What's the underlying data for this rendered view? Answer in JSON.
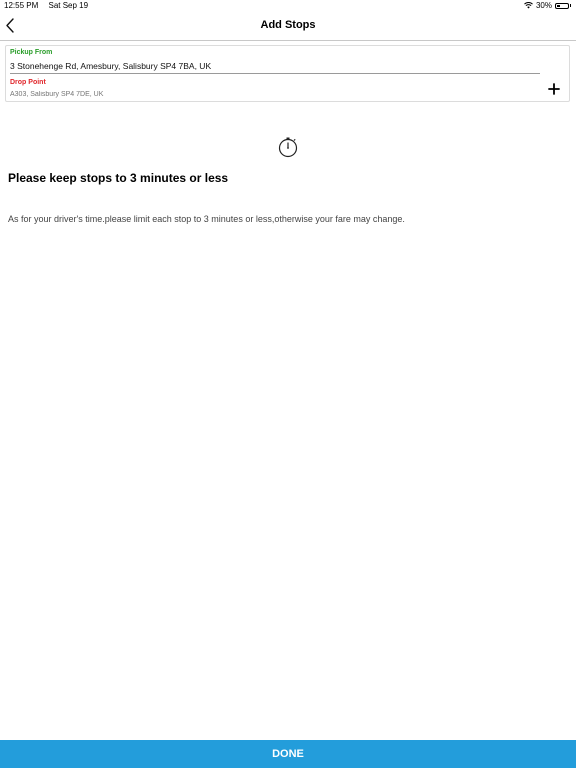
{
  "status_bar": {
    "time": "12:55 PM",
    "date": "Sat Sep 19",
    "battery": "30%",
    "battery_level": 0.3,
    "icons": [
      "wifi-icon",
      "battery-icon"
    ]
  },
  "nav": {
    "title": "Add Stops",
    "back_icon": "chevron-left-icon"
  },
  "stops": {
    "pickup_label": "Pickup From",
    "pickup_value": "3 Stonehenge Rd, Amesbury, Salisbury SP4 7BA, UK",
    "drop_label": "Drop Point",
    "drop_placeholder": "A303, Salisbury SP4 7DE, UK",
    "add_icon": "plus-icon"
  },
  "notice": {
    "icon": "stopwatch-icon",
    "title": "Please keep stops to 3 minutes or less",
    "body": "As for your driver's time.please limit each stop to 3 minutes or less,otherwise your fare may change."
  },
  "footer": {
    "done_label": "DONE"
  },
  "colors": {
    "pickup_label": "#2a9d2a",
    "drop_label": "#e0262b",
    "done_button": "#239ddb"
  }
}
